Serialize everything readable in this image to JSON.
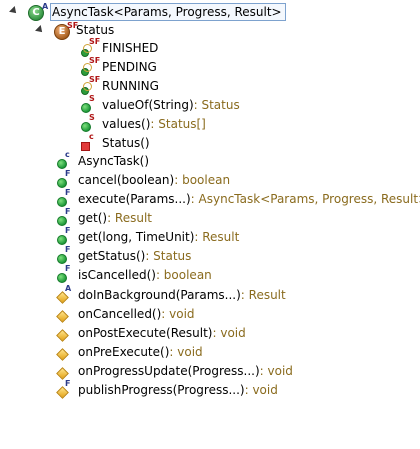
{
  "root": {
    "badge": "C",
    "modifier": "A",
    "label": "AsyncTask<Params, Progress, Result>",
    "icon": "class-icon"
  },
  "enum_node": {
    "badge": "E",
    "modifier": "SF",
    "label": "Status",
    "icon": "enum-icon",
    "constants": [
      {
        "label": "FINISHED",
        "modifier": "SF"
      },
      {
        "label": "PENDING",
        "modifier": "SF"
      },
      {
        "label": "RUNNING",
        "modifier": "SF"
      }
    ],
    "methods": [
      {
        "label": "valueOf(String)",
        "type": " : Status",
        "modifier": "S",
        "icon": "public-method-icon"
      },
      {
        "label": "values()",
        "type": " : Status[]",
        "modifier": "S",
        "icon": "public-method-icon"
      },
      {
        "label": "Status()",
        "type": "",
        "modifier": "c",
        "icon": "private-method-icon"
      }
    ]
  },
  "members": [
    {
      "label": "AsyncTask()",
      "type": "",
      "modifier": "c",
      "icon": "public-method-icon"
    },
    {
      "label": "cancel(boolean)",
      "type": " : boolean",
      "modifier": "F",
      "icon": "public-method-icon"
    },
    {
      "label": "execute(Params...)",
      "type": " : AsyncTask<Params, Progress, Result>",
      "modifier": "F",
      "icon": "public-method-icon"
    },
    {
      "label": "get()",
      "type": " : Result",
      "modifier": "F",
      "icon": "public-method-icon"
    },
    {
      "label": "get(long, TimeUnit)",
      "type": " : Result",
      "modifier": "F",
      "icon": "public-method-icon"
    },
    {
      "label": "getStatus()",
      "type": " : Status",
      "modifier": "F",
      "icon": "public-method-icon"
    },
    {
      "label": "isCancelled()",
      "type": " : boolean",
      "modifier": "F",
      "icon": "public-method-icon"
    },
    {
      "label": "doInBackground(Params...)",
      "type": " : Result",
      "modifier": "A",
      "icon": "protected-method-icon"
    },
    {
      "label": "onCancelled()",
      "type": " : void",
      "modifier": "",
      "icon": "protected-method-icon"
    },
    {
      "label": "onPostExecute(Result)",
      "type": " : void",
      "modifier": "",
      "icon": "protected-method-icon"
    },
    {
      "label": "onPreExecute()",
      "type": " : void",
      "modifier": "",
      "icon": "protected-method-icon"
    },
    {
      "label": "onProgressUpdate(Progress...)",
      "type": " : void",
      "modifier": "",
      "icon": "protected-method-icon"
    },
    {
      "label": "publishProgress(Progress...)",
      "type": " : void",
      "modifier": "F",
      "icon": "protected-method-icon"
    }
  ]
}
